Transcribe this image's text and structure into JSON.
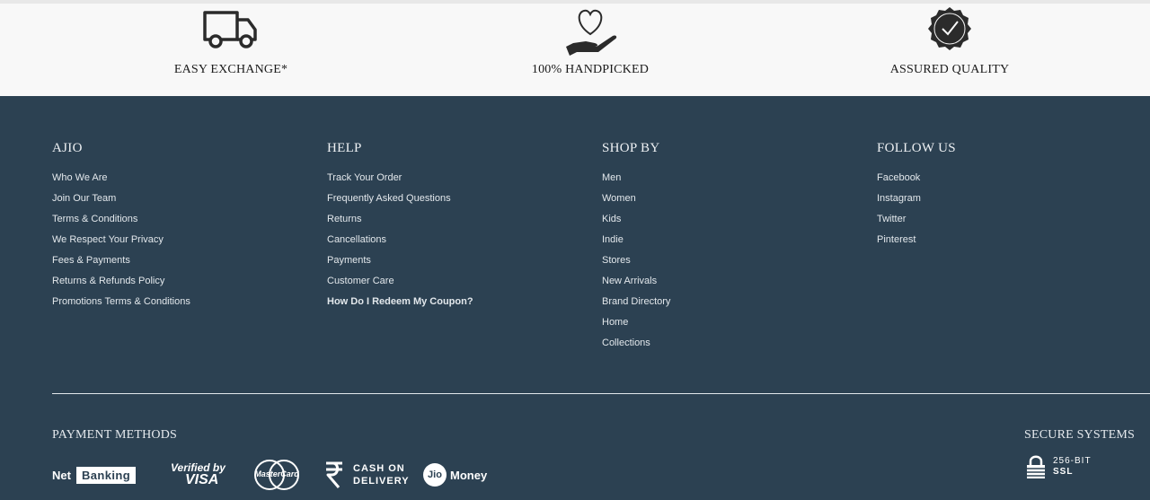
{
  "features": [
    {
      "label": "EASY EXCHANGE*",
      "icon": "truck-icon"
    },
    {
      "label": "100% HANDPICKED",
      "icon": "heart-hand-icon"
    },
    {
      "label": "ASSURED QUALITY",
      "icon": "badge-check-icon"
    }
  ],
  "footer": {
    "columns": [
      {
        "title": "AJIO",
        "items": [
          "Who We Are",
          "Join Our Team",
          "Terms & Conditions",
          "We Respect Your Privacy",
          "Fees & Payments",
          "Returns & Refunds Policy",
          "Promotions Terms & Conditions"
        ]
      },
      {
        "title": "HELP",
        "items": [
          "Track Your Order",
          "Frequently Asked Questions",
          "Returns",
          "Cancellations",
          "Payments",
          "Customer Care",
          "How Do I Redeem My Coupon?"
        ]
      },
      {
        "title": "SHOP BY",
        "items": [
          "Men",
          "Women",
          "Kids",
          "Indie",
          "Stores",
          "New Arrivals",
          "Brand Directory",
          "Home",
          "Collections"
        ]
      },
      {
        "title": "FOLLOW US",
        "items": [
          "Facebook",
          "Instagram",
          "Twitter",
          "Pinterest"
        ]
      }
    ],
    "payment": {
      "title": "PAYMENT METHODS",
      "netbanking": {
        "part1": "Net",
        "part2": "Banking"
      },
      "visa": {
        "line1": "Verified by",
        "line2": "VISA"
      },
      "mastercard": "MasterCard",
      "cod": {
        "symbol": "₹",
        "line1": "CASH ON",
        "line2": "DELIVERY"
      },
      "jio": {
        "badge": "Jio",
        "text": "Money"
      }
    },
    "secure": {
      "title": "SECURE SYSTEMS",
      "line1": "256-BIT",
      "line2": "SSL"
    }
  },
  "colors": {
    "footer_bg": "#2c4152",
    "feature_bg": "#f8f8f8",
    "text_light": "#e3e8ec"
  }
}
